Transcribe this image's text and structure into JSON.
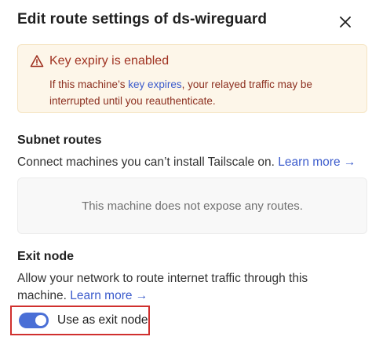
{
  "dialog": {
    "title": "Edit route settings of ds-wireguard",
    "close_icon": "close-icon"
  },
  "warning": {
    "icon": "warning-triangle-icon",
    "title": "Key expiry is enabled",
    "body_before": "If this machine’s ",
    "body_link": "key expires",
    "body_after": ", your relayed traffic may be interrupted until you reauthenticate.",
    "color_text": "#a03322",
    "color_bg": "#fdf6e9"
  },
  "subnet": {
    "title": "Subnet routes",
    "description": "Connect machines you can’t install Tailscale on.",
    "learn_more": "Learn more →",
    "empty_text": "This machine does not expose any routes."
  },
  "exit_node": {
    "title": "Exit node",
    "description": "Allow your network to route internet traffic through this machine.",
    "learn_more": "Learn more →",
    "toggle_label": "Use as exit node",
    "toggle_on": true,
    "accent": "#4a6fd6"
  }
}
